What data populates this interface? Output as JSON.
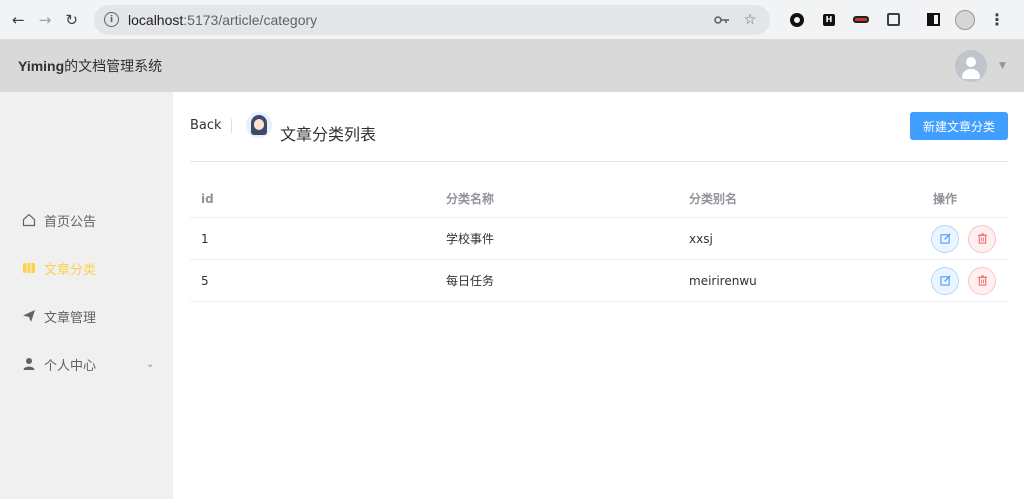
{
  "browser": {
    "url_host": "localhost",
    "url_path": ":5173/article/category"
  },
  "app": {
    "title_bold": "Yiming",
    "title_rest": "的文档管理系统"
  },
  "sidebar": {
    "items": [
      {
        "label": "首页公告",
        "icon": "home-icon",
        "active": false
      },
      {
        "label": "文章分类",
        "icon": "category-icon",
        "active": true
      },
      {
        "label": "文章管理",
        "icon": "send-icon",
        "active": false
      },
      {
        "label": "个人中心",
        "icon": "user-icon",
        "active": false,
        "has_submenu": true
      }
    ]
  },
  "page": {
    "back_label": "Back",
    "title": "文章分类列表",
    "new_button_label": "新建文章分类"
  },
  "table": {
    "columns": [
      "id",
      "分类名称",
      "分类别名",
      "操作"
    ],
    "rows": [
      {
        "id": "1",
        "name": "学校事件",
        "alias": "xxsj"
      },
      {
        "id": "5",
        "name": "每日任务",
        "alias": "meirirenwu"
      }
    ]
  },
  "colors": {
    "primary": "#409eff",
    "active_menu": "#ffd04b",
    "danger": "#f56c6c"
  }
}
